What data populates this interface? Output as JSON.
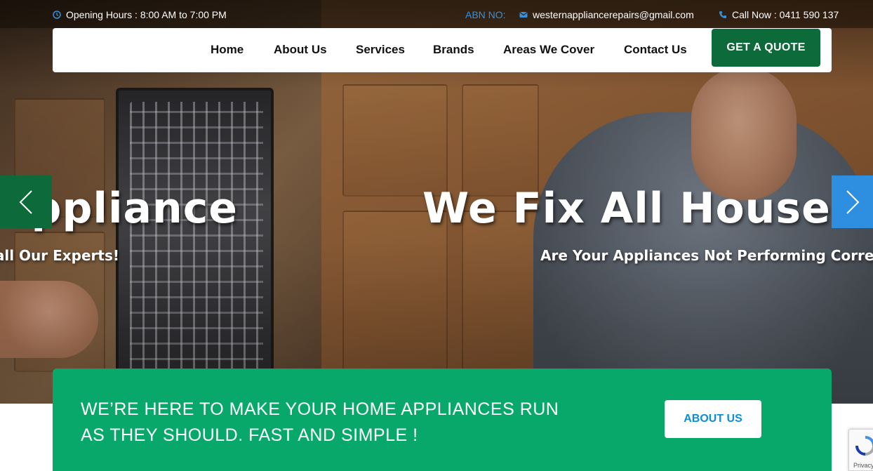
{
  "topbar": {
    "hours": "Opening Hours : 8:00 AM to 7:00 PM",
    "abn_label": "ABN NO:",
    "email": "westernappliancerepairs@gmail.com",
    "phone": "Call Now : 0411 590 137",
    "icons": {
      "hours": "clock-icon",
      "email": "envelope-icon",
      "phone": "phone-icon"
    }
  },
  "nav": {
    "items": [
      {
        "label": "Home"
      },
      {
        "label": "About Us"
      },
      {
        "label": "Services"
      },
      {
        "label": "Brands"
      },
      {
        "label": "Areas We Cover"
      },
      {
        "label": "Contact Us"
      }
    ],
    "cta": "GET A QUOTE"
  },
  "slider": {
    "prev_slide": {
      "heading": "ppliance",
      "subheading": "Call Our Experts!"
    },
    "current_slide": {
      "heading": "We Fix All Househo",
      "subheading": "Are Your Appliances Not Performing Correctly"
    },
    "controls": {
      "prev": "chevron-left-icon",
      "next": "chevron-right-icon"
    }
  },
  "banner": {
    "line1": "WE’RE HERE TO MAKE YOUR HOME APPLIANCES RUN",
    "line2": "AS THEY SHOULD. FAST AND SIMPLE !",
    "button": "ABOUT US"
  },
  "recaptcha": {
    "label": "Privacy"
  },
  "colors": {
    "brand_dark_green": "#0d6a3a",
    "banner_green": "#07a86a",
    "accent_blue": "#2e8fe0",
    "abn_blue": "#3a8fd6"
  }
}
